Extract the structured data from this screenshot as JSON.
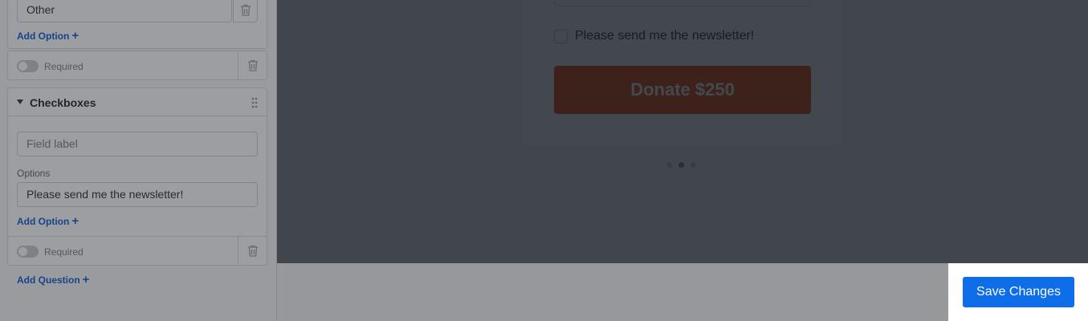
{
  "sidebar": {
    "other_option_value": "Other",
    "add_option_label": "Add Option",
    "required_label": "Required",
    "checkboxes_section_title": "Checkboxes",
    "field_label_placeholder": "Field label",
    "options_label": "Options",
    "newsletter_option_value": "Please send me the newsletter!",
    "add_question_label": "Add Question"
  },
  "preview": {
    "checkbox_label": "Please send me the newsletter!",
    "donate_button_label": "Donate $250",
    "carousel_dots": 3,
    "active_dot_index": 1
  },
  "footer": {
    "save_button_label": "Save Changes"
  },
  "colors": {
    "accent_blue": "#0e6de8",
    "donate_orange": "#e6551d",
    "link_blue": "#1e63d6"
  }
}
